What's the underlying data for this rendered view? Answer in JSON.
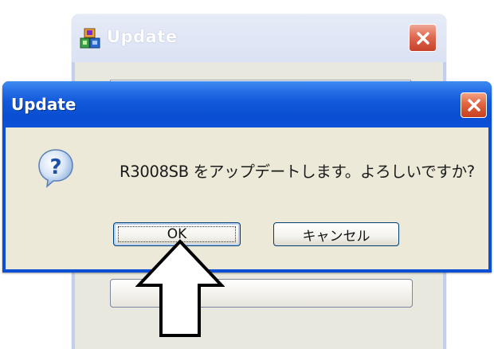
{
  "background_window": {
    "title": "Update",
    "app_icon": "package-icon",
    "close_icon": "close-icon"
  },
  "dialog": {
    "title": "Update",
    "close_icon": "close-icon",
    "message_icon": "question-icon",
    "message": "R3008SB をアップデートします。よろしいですか?",
    "ok_label": "OK",
    "cancel_label": "キャンセル"
  },
  "annotation": {
    "pointer_icon": "up-arrow-icon"
  },
  "colors": {
    "xp_titlebar_blue": "#0b50d6",
    "xp_close_red": "#e2643e",
    "dialog_face": "#ece9d8"
  }
}
